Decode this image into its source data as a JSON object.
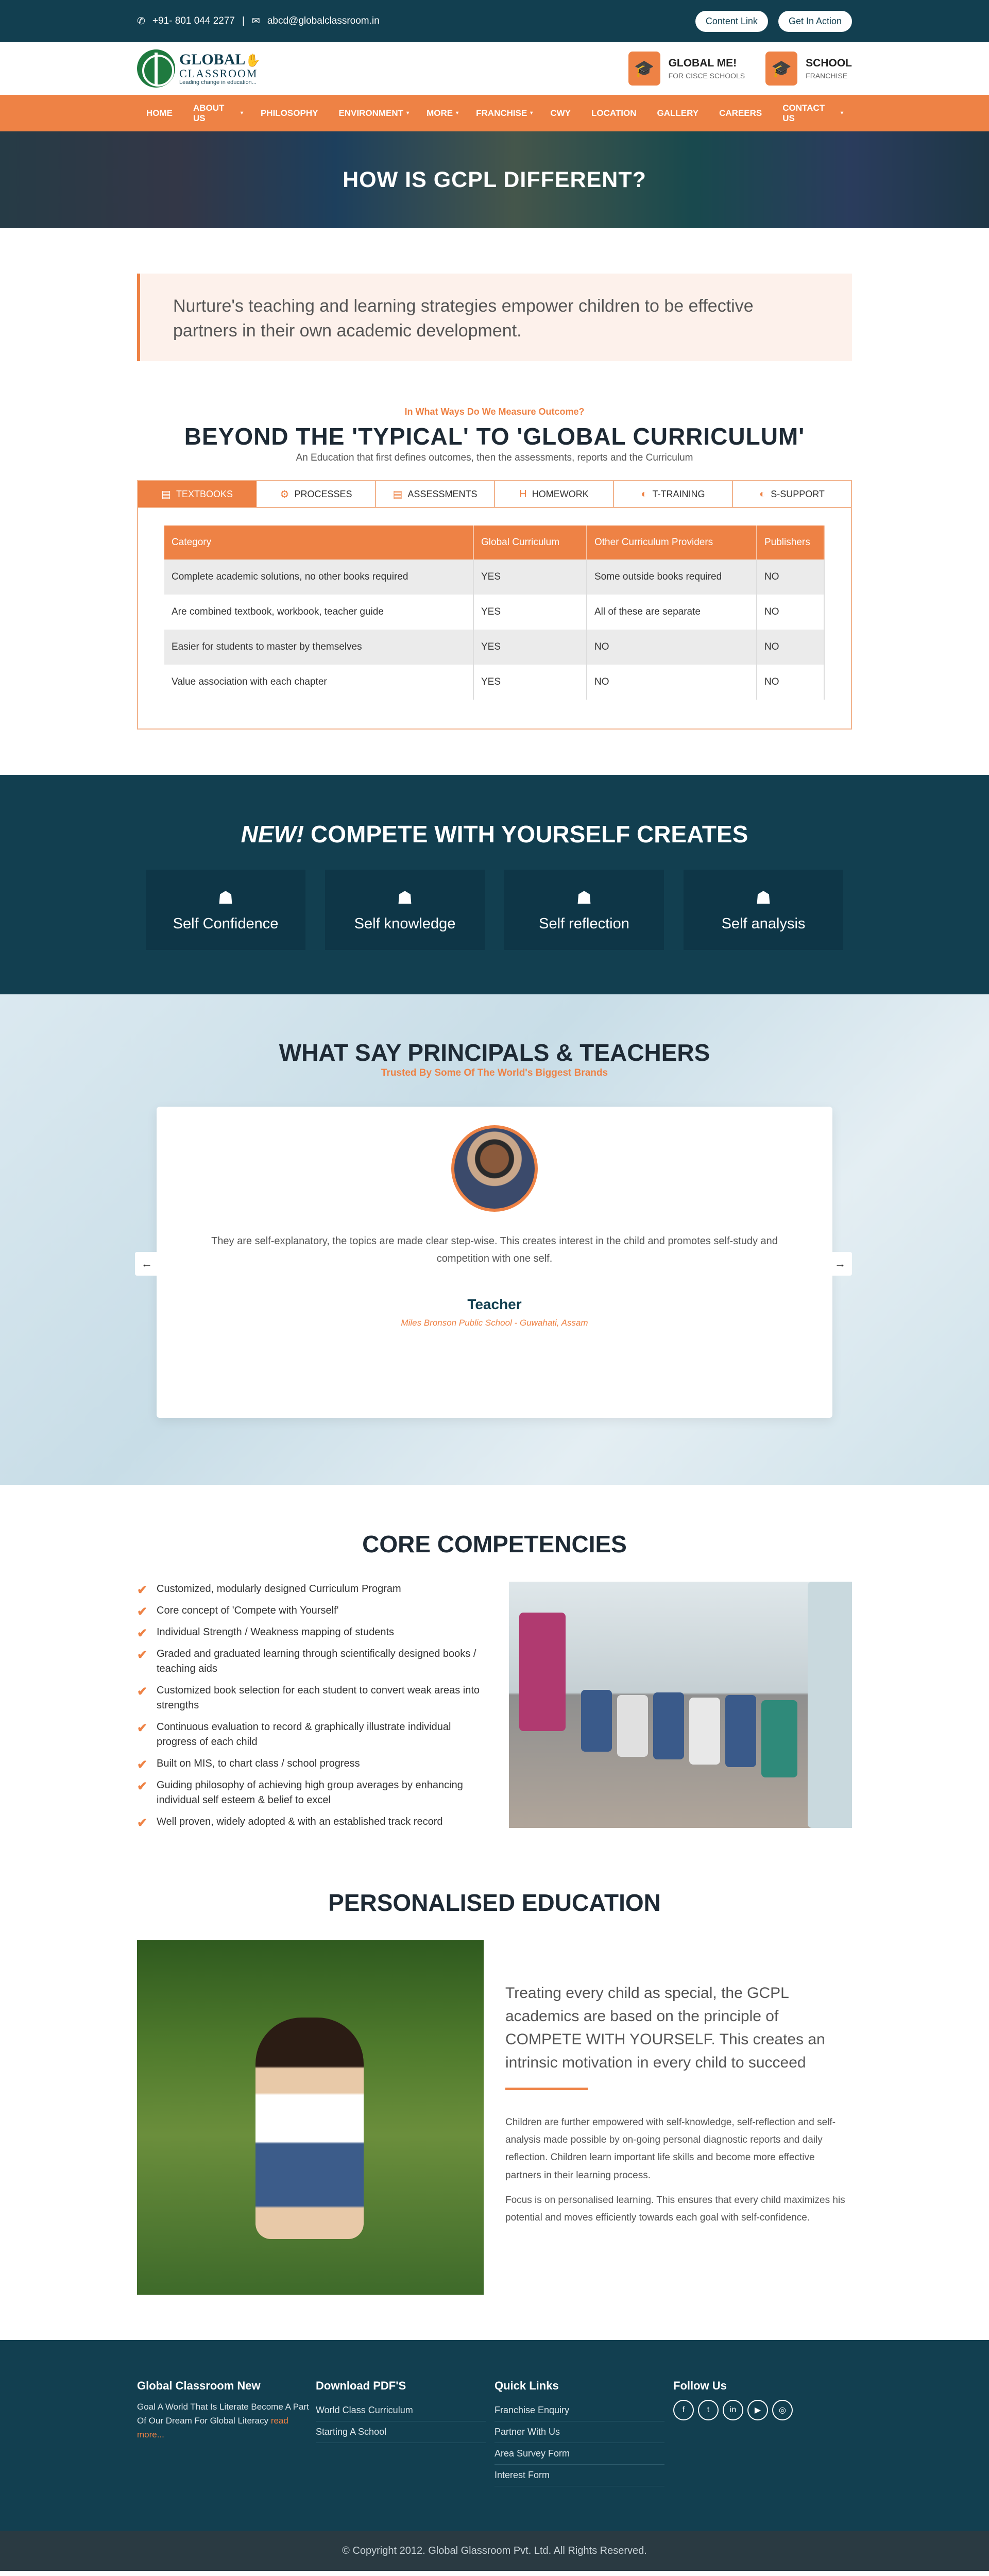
{
  "topbar": {
    "phone": "+91- 801 044 2277",
    "email": "abcd@globalclassroom.in",
    "content_link": "Content Link",
    "get_in_action": "Get In Action"
  },
  "header": {
    "logo_line1": "GLOBAL",
    "logo_line2": "CLASSROOM",
    "logo_tagline": "Leading change in education...",
    "boxes": [
      {
        "title": "GLOBAL ME!",
        "sub": "FOR CISCE SCHOOLS"
      },
      {
        "title": "SCHOOL",
        "sub": "FRANCHISE"
      }
    ]
  },
  "nav": [
    {
      "label": "HOME",
      "caret": ""
    },
    {
      "label": "ABOUT US",
      "caret": "▾"
    },
    {
      "label": "PHILOSOPHY",
      "caret": ""
    },
    {
      "label": "ENVIRONMENT",
      "caret": "▾"
    },
    {
      "label": "MORE",
      "caret": "▾"
    },
    {
      "label": "FRANCHISE",
      "caret": "▾"
    },
    {
      "label": "CWY",
      "caret": ""
    },
    {
      "label": "LOCATION",
      "caret": ""
    },
    {
      "label": "GALLERY",
      "caret": ""
    },
    {
      "label": "CAREERS",
      "caret": ""
    },
    {
      "label": "CONTACT US",
      "caret": "▾"
    }
  ],
  "hero": {
    "title": "HOW IS GCPL DIFFERENT?"
  },
  "quote": "Nurture's teaching and learning strategies empower children to be effective partners in their own academic development.",
  "curriculum": {
    "sub": "In What Ways Do We Measure Outcome?",
    "title": "BEYOND THE 'TYPICAL' TO 'GLOBAL CURRICULUM'",
    "desc": "An Education that first defines outcomes, then the assessments, reports and the Curriculum",
    "tabs": [
      {
        "label": "TEXTBOOKS",
        "icon": "▤"
      },
      {
        "label": "PROCESSES",
        "icon": "⚙"
      },
      {
        "label": "ASSESSMENTS",
        "icon": "▤"
      },
      {
        "label": "HOMEWORK",
        "icon": "H"
      },
      {
        "label": "T-TRAINING",
        "icon": "◐"
      },
      {
        "label": "S-SUPPORT",
        "icon": "◐"
      }
    ],
    "headers": [
      "Category",
      "Global Curriculum",
      "Other Curriculum Providers",
      "Publishers"
    ],
    "rows": [
      [
        "Complete academic solutions, no other books required",
        "YES",
        "Some outside books required",
        "NO"
      ],
      [
        "Are combined textbook, workbook, teacher guide",
        "YES",
        "All of these are separate",
        "NO"
      ],
      [
        "Easier for students to master by themselves",
        "YES",
        "NO",
        "NO"
      ],
      [
        "Value association with each chapter",
        "YES",
        "NO",
        "NO"
      ]
    ]
  },
  "compete": {
    "title_em": "NEW!",
    "title_rest": " COMPETE WITH YOURSELF CREATES",
    "cards": [
      "Self Confidence",
      "Self knowledge",
      "Self reflection",
      "Self analysis"
    ]
  },
  "testimonials": {
    "title": "WHAT SAY PRINCIPALS & TEACHERS",
    "sub": "Trusted By Some Of The World's Biggest Brands",
    "quote": "They are self-explanatory, the topics are made clear step-wise. This creates interest in the child and promotes self-study and competition with one self.",
    "name": "Teacher",
    "school": "Miles Bronson Public School - Guwahati, Assam",
    "prev": "←",
    "next": "→"
  },
  "core": {
    "title": "CORE COMPETENCIES",
    "items": [
      "Customized, modularly designed Curriculum Program",
      "Core concept of 'Compete with Yourself'",
      "Individual Strength / Weakness mapping of students",
      "Graded and graduated learning through scientifically designed books / teaching aids",
      "Customized book selection for each student to convert weak areas into strengths",
      "Continuous evaluation to record & graphically illustrate individual progress of each child",
      "Built on MIS, to chart class / school progress",
      "Guiding philosophy of achieving high group averages by enhancing individual self esteem & belief to excel",
      "Well proven, widely adopted & with an established track record"
    ]
  },
  "personalised": {
    "title": "PERSONALISED EDUCATION",
    "lead": "Treating every child as special, the GCPL academics are based on the principle of COMPETE WITH YOURSELF. This creates an intrinsic motivation in every child to succeed",
    "p1": "Children are further empowered with self-knowledge, self-reflection and self-analysis made possible by on-going personal diagnostic reports and daily reflection. Children learn important life skills and become more effective partners in their learning process.",
    "p2": "Focus is on personalised learning. This ensures that every child maximizes his potential and moves efficiently towards each goal with self-confidence."
  },
  "footer": {
    "col1_title": "Global Classroom New",
    "col1_text": "Goal A World That Is Literate Become A Part Of Our Dream For Global Literacy",
    "col1_more": "read more...",
    "col2_title": "Download PDF'S",
    "col2_links": [
      "World Class Curriculum",
      "Starting A School"
    ],
    "col3_title": "Quick Links",
    "col3_links": [
      "Franchise Enquiry",
      "Partner With Us",
      "Area Survey Form",
      "Interest Form"
    ],
    "col4_title": "Follow Us",
    "socials": [
      "f",
      "t",
      "in",
      "▶",
      "◎"
    ],
    "copyright": "© Copyright 2012. Global Glassroom Pvt. Ltd. All Rights Reserved."
  }
}
